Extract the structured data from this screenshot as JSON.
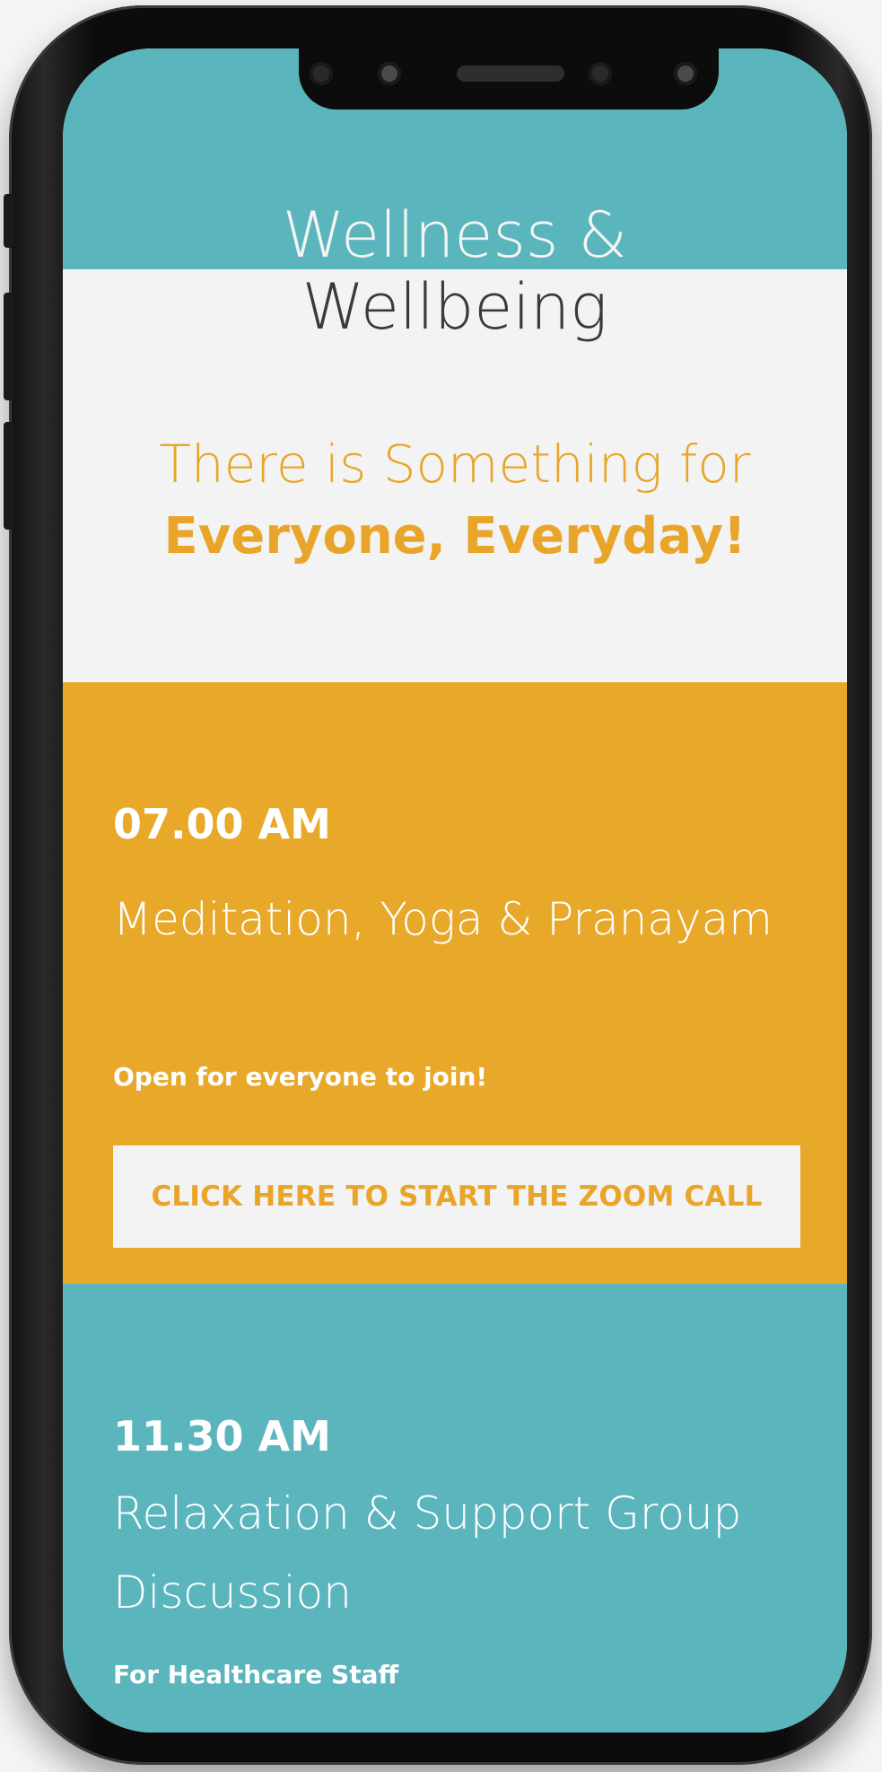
{
  "app": {
    "logo_line1": "Wellness &",
    "logo_line2": "Wellbeing"
  },
  "hero": {
    "tagline_line1": "There is Something for",
    "tagline_line2": "Everyone, Everyday!"
  },
  "sessions": [
    {
      "time": "07.00 AM",
      "title": "Meditation, Yoga & Pranayam",
      "note": "Open for everyone to join!",
      "button_label": "CLICK HERE TO START THE ZOOM CALL"
    },
    {
      "time": "11.30 AM",
      "title": "Relaxation & Support Group Discussion",
      "note": "For Healthcare Staff",
      "button_label": ""
    }
  ],
  "colors": {
    "teal": "#5bb5bd",
    "amber": "#e8a82a",
    "off_white": "#f3f3f3",
    "logo_dark": "#3a3a3a"
  },
  "icons": [
    "front-camera-icon",
    "proximity-sensor-icon",
    "earpiece-speaker-icon"
  ]
}
